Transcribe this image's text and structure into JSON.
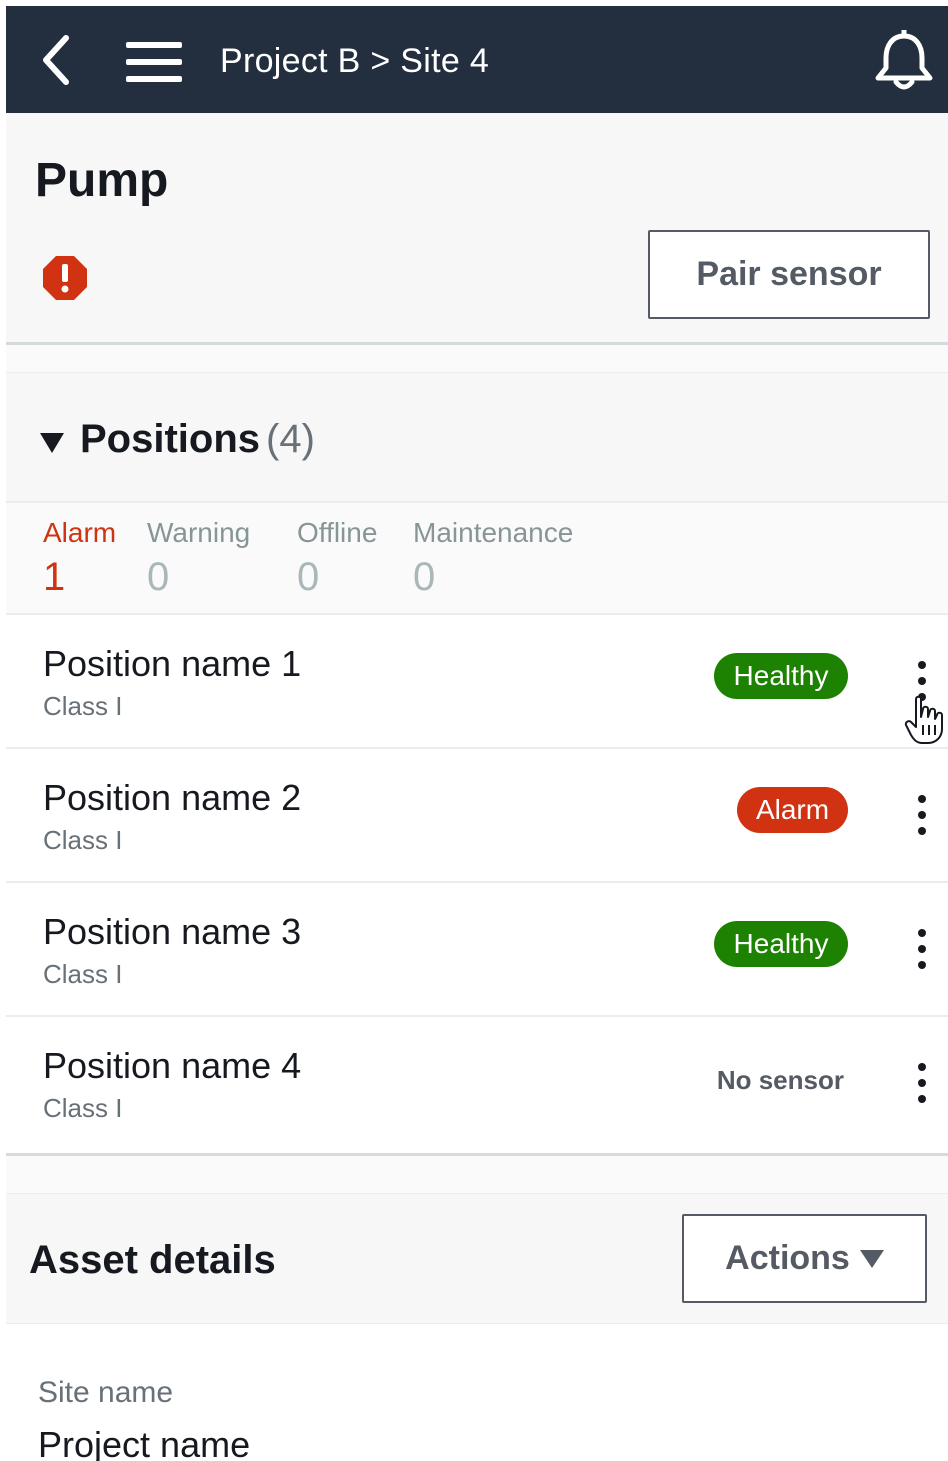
{
  "topbar": {
    "breadcrumb": "Project B > Site 4",
    "back_icon": "chevron-left-icon",
    "menu_icon": "hamburger-menu-icon",
    "notification_icon": "bell-icon"
  },
  "header": {
    "title": "Pump",
    "status_icon": "alert-octagon-icon",
    "pair_button": "Pair sensor"
  },
  "positions": {
    "title": "Positions",
    "count": "(4)",
    "stats": [
      {
        "label": "Alarm",
        "value": "1"
      },
      {
        "label": "Warning",
        "value": "0"
      },
      {
        "label": "Offline",
        "value": "0"
      },
      {
        "label": "Maintenance",
        "value": "0"
      }
    ],
    "items": [
      {
        "name": "Position name 1",
        "class": "Class I",
        "status": "Healthy"
      },
      {
        "name": "Position name 2",
        "class": "Class I",
        "status": "Alarm"
      },
      {
        "name": "Position name 3",
        "class": "Class I",
        "status": "Healthy"
      },
      {
        "name": "Position name 4",
        "class": "Class I",
        "status": "No sensor"
      }
    ]
  },
  "asset_details": {
    "title": "Asset details",
    "actions_button": "Actions",
    "fields": [
      {
        "label": "Site name",
        "value": "Project name"
      }
    ]
  },
  "colors": {
    "topbar_bg": "#232f3e",
    "healthy": "#1d8102",
    "alarm": "#d13212",
    "muted": "#879596"
  }
}
